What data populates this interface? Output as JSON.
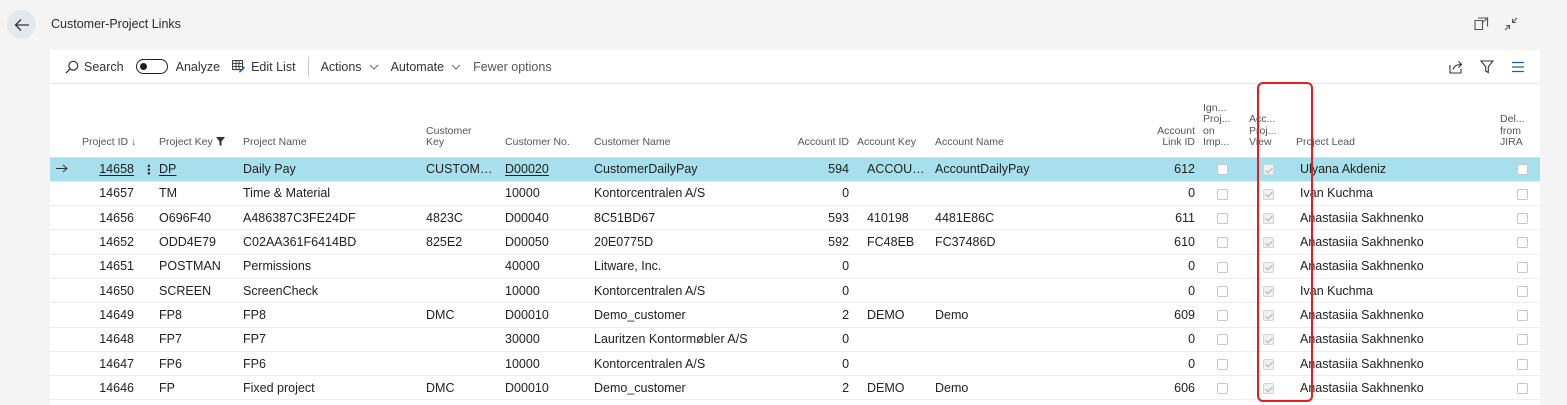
{
  "page": {
    "title": "Customer-Project Links"
  },
  "icons": {
    "back": "back-arrow-icon",
    "open_new": "open-in-new-window-icon",
    "collapse": "collapse-icon",
    "search": "search-icon",
    "edit_list": "edit-list-icon",
    "share": "share-icon",
    "filter": "filter-icon",
    "list_view": "list-view-icon"
  },
  "actionbar": {
    "search": "Search",
    "analyze": "Analyze",
    "edit_list": "Edit List",
    "actions": "Actions",
    "automate": "Automate",
    "fewer_options": "Fewer options"
  },
  "columns": [
    {
      "label": "Project ID ↓",
      "align": "left"
    },
    {
      "label": "Project Key",
      "align": "left"
    },
    {
      "label": "Project Name",
      "align": "left"
    },
    {
      "label": "Customer Key",
      "align": "left"
    },
    {
      "label": "Customer No.",
      "align": "left"
    },
    {
      "label": "Customer Name",
      "align": "left"
    },
    {
      "label": "Account ID",
      "align": "right"
    },
    {
      "label": "Account Key",
      "align": "left"
    },
    {
      "label": "Account Name",
      "align": "left"
    },
    {
      "label": "Account Link ID",
      "align": "right"
    },
    {
      "label": "Ign... Proj... on Imp...",
      "align": "left"
    },
    {
      "label": "Acc... Proj... View",
      "align": "left"
    },
    {
      "label": "Project Lead",
      "align": "left"
    },
    {
      "label": "Del... from JIRA",
      "align": "right"
    }
  ],
  "rows": [
    {
      "project_id": "14658",
      "project_key": "DP",
      "project_name": "Daily Pay",
      "customer_key": "CUSTOMER...",
      "customer_no": "D00020",
      "customer_name": "CustomerDailyPay",
      "account_id": "594",
      "account_key": "ACCOUNT...",
      "account_name": "AccountDailyPay",
      "account_link_id": "612",
      "ignore": false,
      "access": true,
      "project_lead": "Ulyana Akdeniz",
      "deleted": false
    },
    {
      "project_id": "14657",
      "project_key": "TM",
      "project_name": "Time & Material",
      "customer_key": "",
      "customer_no": "10000",
      "customer_name": "Kontorcentralen A/S",
      "account_id": "0",
      "account_key": "",
      "account_name": "",
      "account_link_id": "0",
      "ignore": false,
      "access": true,
      "project_lead": "Ivan Kuchma",
      "deleted": false
    },
    {
      "project_id": "14656",
      "project_key": "O696F40",
      "project_name": "A486387C3FE24DF",
      "customer_key": "4823C",
      "customer_no": "D00040",
      "customer_name": "8C51BD67",
      "account_id": "593",
      "account_key": "410198",
      "account_name": "4481E86C",
      "account_link_id": "611",
      "ignore": false,
      "access": true,
      "project_lead": "Anastasiia Sakhnenko",
      "deleted": false
    },
    {
      "project_id": "14652",
      "project_key": "ODD4E79",
      "project_name": "C02AA361F6414BD",
      "customer_key": "825E2",
      "customer_no": "D00050",
      "customer_name": "20E0775D",
      "account_id": "592",
      "account_key": "FC48EB",
      "account_name": "FC37486D",
      "account_link_id": "610",
      "ignore": false,
      "access": true,
      "project_lead": "Anastasiia Sakhnenko",
      "deleted": false
    },
    {
      "project_id": "14651",
      "project_key": "POSTMAN",
      "project_name": "Permissions",
      "customer_key": "",
      "customer_no": "40000",
      "customer_name": "Litware, Inc.",
      "account_id": "0",
      "account_key": "",
      "account_name": "",
      "account_link_id": "0",
      "ignore": false,
      "access": true,
      "project_lead": "Anastasiia Sakhnenko",
      "deleted": false
    },
    {
      "project_id": "14650",
      "project_key": "SCREEN",
      "project_name": "ScreenCheck",
      "customer_key": "",
      "customer_no": "10000",
      "customer_name": "Kontorcentralen A/S",
      "account_id": "0",
      "account_key": "",
      "account_name": "",
      "account_link_id": "0",
      "ignore": false,
      "access": true,
      "project_lead": "Ivan Kuchma",
      "deleted": false
    },
    {
      "project_id": "14649",
      "project_key": "FP8",
      "project_name": "FP8",
      "customer_key": "DMC",
      "customer_no": "D00010",
      "customer_name": "Demo_customer",
      "account_id": "2",
      "account_key": "DEMO",
      "account_name": "Demo",
      "account_link_id": "609",
      "ignore": false,
      "access": true,
      "project_lead": "Anastasiia Sakhnenko",
      "deleted": false
    },
    {
      "project_id": "14648",
      "project_key": "FP7",
      "project_name": "FP7",
      "customer_key": "",
      "customer_no": "30000",
      "customer_name": "Lauritzen Kontormøbler A/S",
      "account_id": "0",
      "account_key": "",
      "account_name": "",
      "account_link_id": "0",
      "ignore": false,
      "access": true,
      "project_lead": "Anastasiia Sakhnenko",
      "deleted": false
    },
    {
      "project_id": "14647",
      "project_key": "FP6",
      "project_name": "FP6",
      "customer_key": "",
      "customer_no": "10000",
      "customer_name": "Kontorcentralen A/S",
      "account_id": "0",
      "account_key": "",
      "account_name": "",
      "account_link_id": "0",
      "ignore": false,
      "access": true,
      "project_lead": "Anastasiia Sakhnenko",
      "deleted": false
    },
    {
      "project_id": "14646",
      "project_key": "FP",
      "project_name": "Fixed project",
      "customer_key": "DMC",
      "customer_no": "D00010",
      "customer_name": "Demo_customer",
      "account_id": "2",
      "account_key": "DEMO",
      "account_name": "Demo",
      "account_link_id": "606",
      "ignore": false,
      "access": true,
      "project_lead": "Anastasiia Sakhnenko",
      "deleted": false
    }
  ],
  "selected_row": 0,
  "colors": {
    "selected_row": "#a8dfec",
    "highlight": "#e02020"
  }
}
